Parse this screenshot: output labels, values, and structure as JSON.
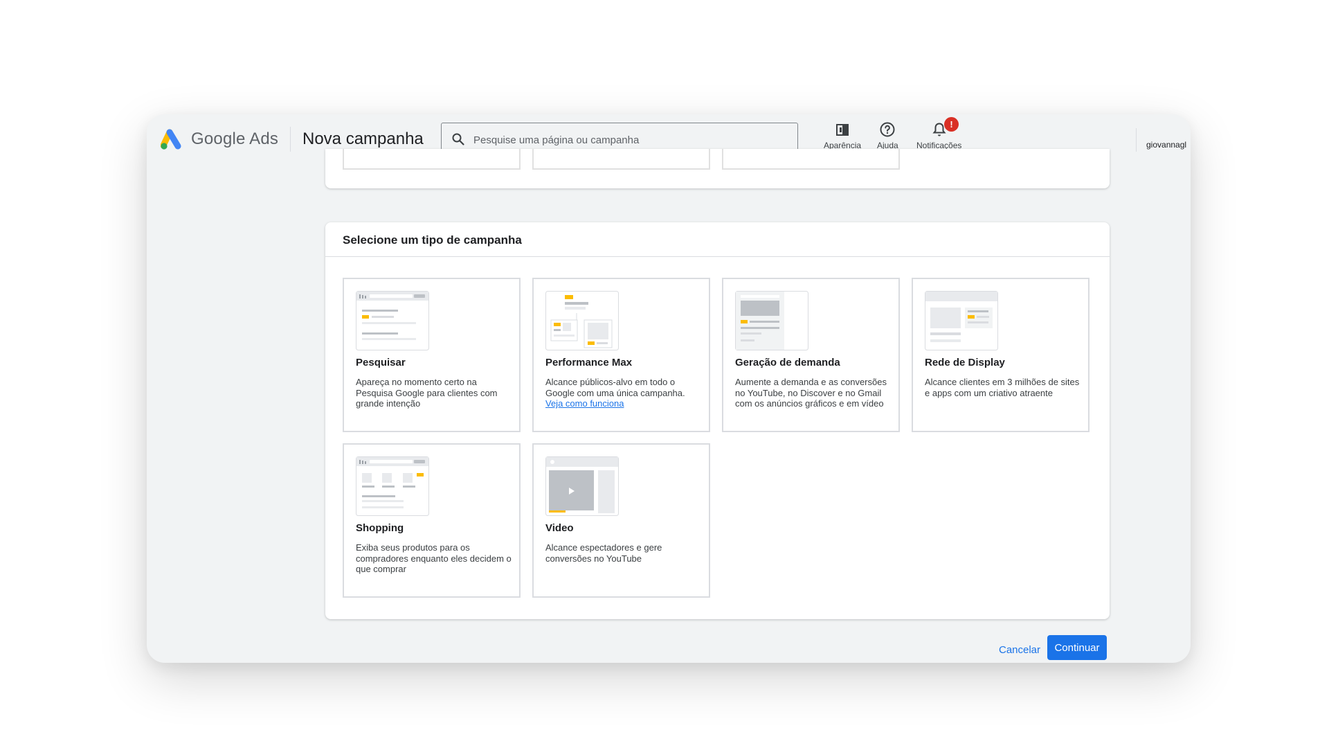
{
  "header": {
    "brand": "Google Ads",
    "page_title": "Nova campanha",
    "search_placeholder": "Pesquise uma página ou campanha",
    "tools": [
      {
        "label": "Aparência",
        "icon": "appearance-icon"
      },
      {
        "label": "Ajuda",
        "icon": "help-icon"
      },
      {
        "label": "Notificações",
        "icon": "bell-icon",
        "badge": "!"
      }
    ],
    "account": "giovannagl"
  },
  "section": {
    "title": "Selecione um tipo de campanha",
    "campaign_types": [
      {
        "title": "Pesquisar",
        "description": "Apareça no momento certo na Pesquisa Google para clientes com grande intenção"
      },
      {
        "title": "Performance Max",
        "description": "Alcance públicos-alvo em todo o Google com uma única campanha.",
        "link": "Veja como funciona"
      },
      {
        "title": "Geração de demanda",
        "description": "Aumente a demanda e as conversões no YouTube, no Discover e no Gmail com os anúncios gráficos e em vídeo"
      },
      {
        "title": "Rede de Display",
        "description": "Alcance clientes em 3 milhões de sites e apps com um criativo atraente"
      },
      {
        "title": "Shopping",
        "description": "Exiba seus produtos para os compradores enquanto eles decidem o que comprar"
      },
      {
        "title": "Video",
        "description": "Alcance espectadores e gere conversões no YouTube"
      }
    ]
  },
  "footer": {
    "cancel": "Cancelar",
    "continue": "Continuar"
  },
  "colors": {
    "accent": "#1a73e8",
    "highlight": "#fbbc04",
    "badge": "#d93025"
  }
}
